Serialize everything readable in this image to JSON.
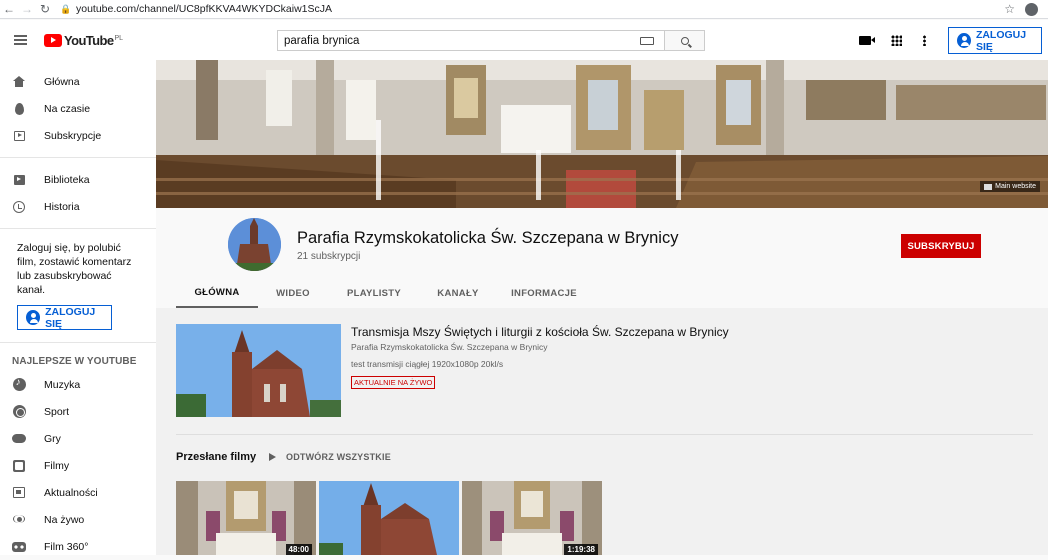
{
  "browser": {
    "url": "youtube.com/channel/UC8pfKKVA4WKYDCkaiw1ScJA"
  },
  "masthead": {
    "logo_text": "YouTube",
    "logo_region": "PL",
    "search_value": "parafia brynica",
    "signin_label": "ZALOGUJ SIĘ"
  },
  "sidebar": {
    "primary": [
      {
        "label": "Główna",
        "icon": "home-icon"
      },
      {
        "label": "Na czasie",
        "icon": "trending-icon"
      },
      {
        "label": "Subskrypcje",
        "icon": "subscriptions-icon"
      }
    ],
    "secondary": [
      {
        "label": "Biblioteka",
        "icon": "library-icon"
      },
      {
        "label": "Historia",
        "icon": "history-icon"
      }
    ],
    "signin_note": "Zaloguj się, by polubić film, zostawić komentarz lub zasubskrybować kanał.",
    "signin_label": "ZALOGUJ SIĘ",
    "best_of_heading": "NAJLEPSZE W YOUTUBE",
    "best_of": [
      {
        "label": "Muzyka",
        "icon": "music-icon"
      },
      {
        "label": "Sport",
        "icon": "sport-icon"
      },
      {
        "label": "Gry",
        "icon": "gaming-icon"
      },
      {
        "label": "Filmy",
        "icon": "movies-icon"
      },
      {
        "label": "Aktualności",
        "icon": "news-icon"
      },
      {
        "label": "Na żywo",
        "icon": "live-icon"
      },
      {
        "label": "Film 360°",
        "icon": "vr360-icon"
      }
    ]
  },
  "banner": {
    "link_label": "Main website"
  },
  "channel": {
    "name": "Parafia Rzymskokatolicka Św. Szczepana w Brynicy",
    "subscribers": "21 subskrypcji",
    "subscribe_label": "SUBSKRYBUJ",
    "tabs": [
      {
        "label": "GŁÓWNA",
        "active": true
      },
      {
        "label": "WIDEO",
        "active": false
      },
      {
        "label": "PLAYLISTY",
        "active": false
      },
      {
        "label": "KANAŁY",
        "active": false
      },
      {
        "label": "INFORMACJE",
        "active": false
      }
    ]
  },
  "featured": {
    "title": "Transmisja Mszy Świętych i liturgii z kościoła Św. Szczepana w Brynicy",
    "channel": "Parafia Rzymskokatolicka Św. Szczepana w Brynicy",
    "description": "test transmisji ciągłej 1920x1080p 20kl/s",
    "badge": "AKTUALNIE NA ŻYWO"
  },
  "uploads": {
    "title": "Przesłane filmy",
    "play_all_label": "ODTWÓRZ WSZYSTKIE",
    "videos": [
      {
        "duration": "48:00",
        "kind": "interior"
      },
      {
        "duration": "",
        "kind": "exterior"
      },
      {
        "duration": "1:19:38",
        "kind": "interior"
      }
    ]
  },
  "colors": {
    "accent_blue": "#065fd4",
    "subscribe_red": "#cc0000",
    "logo_red": "#ff0000"
  }
}
